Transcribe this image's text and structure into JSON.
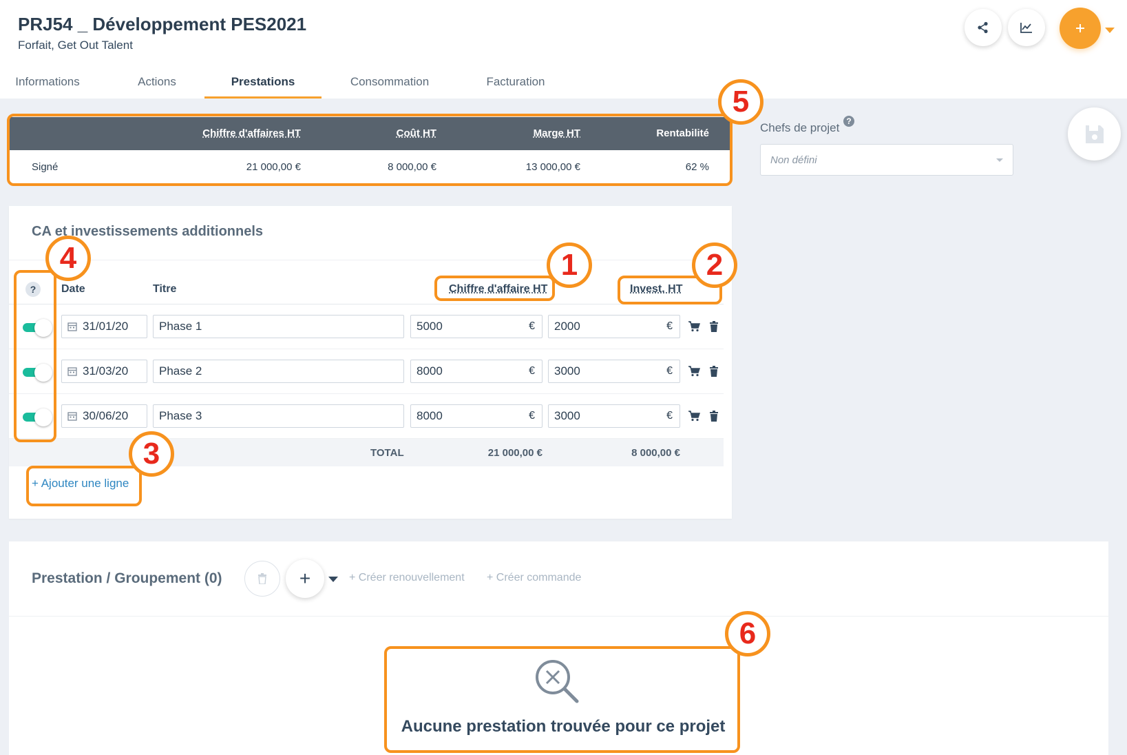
{
  "header": {
    "title": "PRJ54 _ Développement PES2021",
    "subtitle": "Forfait, Get Out Talent"
  },
  "tabs": [
    {
      "label": "Informations",
      "active": false
    },
    {
      "label": "Actions",
      "active": false
    },
    {
      "label": "Prestations",
      "active": true
    },
    {
      "label": "Consommation",
      "active": false
    },
    {
      "label": "Facturation",
      "active": false
    }
  ],
  "summary": {
    "headers": {
      "ca": "Chiffre d'affaires HT",
      "cout": "Coût HT",
      "marge": "Marge HT",
      "rent": "Rentabilité"
    },
    "row": {
      "label": "Signé",
      "ca": "21 000,00 €",
      "cout": "8 000,00 €",
      "marge": "13 000,00 €",
      "rent": "62 %"
    }
  },
  "chefs": {
    "label": "Chefs de projet",
    "help": "?",
    "value": "Non défini"
  },
  "ca_section": {
    "title": "CA et investissements additionnels",
    "help": "?",
    "columns": {
      "date": "Date",
      "titre": "Titre",
      "ca": "Chiffre d'affaire HT",
      "inv": "Invest. HT"
    },
    "rows": [
      {
        "date": "31/01/20",
        "titre": "Phase 1",
        "ca": "5000",
        "inv": "2000",
        "currency": "€",
        "enabled": true
      },
      {
        "date": "31/03/20",
        "titre": "Phase 2",
        "ca": "8000",
        "inv": "3000",
        "currency": "€",
        "enabled": true
      },
      {
        "date": "30/06/20",
        "titre": "Phase 3",
        "ca": "8000",
        "inv": "3000",
        "currency": "€",
        "enabled": true
      }
    ],
    "total": {
      "label": "TOTAL",
      "ca": "21 000,00 €",
      "inv": "8 000,00 €"
    },
    "add_line": "+ Ajouter une ligne"
  },
  "prestations": {
    "title": "Prestation / Groupement (0)",
    "plus": "+",
    "create_renewal": "+ Créer renouvellement",
    "create_order": "+ Créer commande",
    "empty_message": "Aucune prestation trouvée pour ce projet"
  },
  "annotations": [
    "1",
    "2",
    "3",
    "4",
    "5",
    "6"
  ],
  "colors": {
    "accent": "#f7a12d",
    "annotation": "#f7921e",
    "annotation_text": "#e8291c",
    "toggle_on": "#1abc9c",
    "table_head": "#58636e"
  },
  "icons": [
    "share-icon",
    "chart-icon",
    "plus-icon",
    "save-icon",
    "calendar-icon",
    "cart-icon",
    "trash-icon",
    "search-x-icon"
  ]
}
